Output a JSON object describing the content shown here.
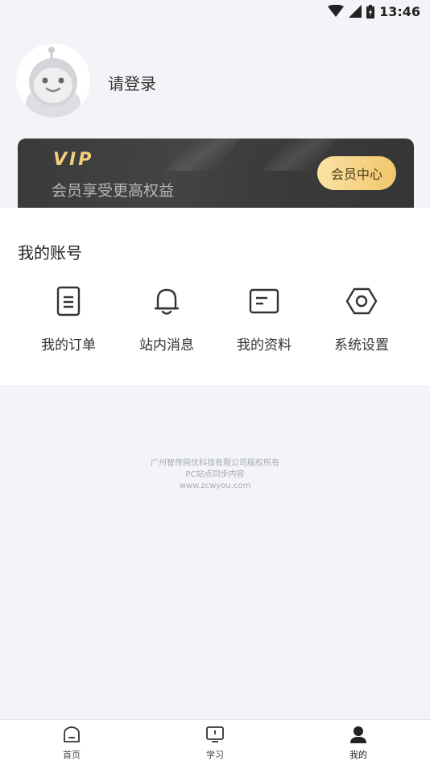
{
  "status_bar": {
    "time": "13:46"
  },
  "profile": {
    "login_text": "请登录"
  },
  "vip": {
    "title": "VIP",
    "subtitle": "会员享受更高权益",
    "button_label": "会员中心"
  },
  "account": {
    "title": "我的账号",
    "items": [
      {
        "label": "我的订单",
        "icon": "document-icon"
      },
      {
        "label": "站内消息",
        "icon": "bell-icon"
      },
      {
        "label": "我的资料",
        "icon": "profile-card-icon"
      },
      {
        "label": "系统设置",
        "icon": "hex-gear-icon"
      }
    ]
  },
  "footer": {
    "line1": "广州智传网优科技有限公司版权所有",
    "line2": "PC站点同步内容",
    "line3": "www.zcwyou.com"
  },
  "nav": {
    "items": [
      {
        "label": "首页",
        "icon": "home-icon"
      },
      {
        "label": "学习",
        "icon": "tv-icon"
      },
      {
        "label": "我的",
        "icon": "person-icon",
        "active": true
      }
    ]
  }
}
